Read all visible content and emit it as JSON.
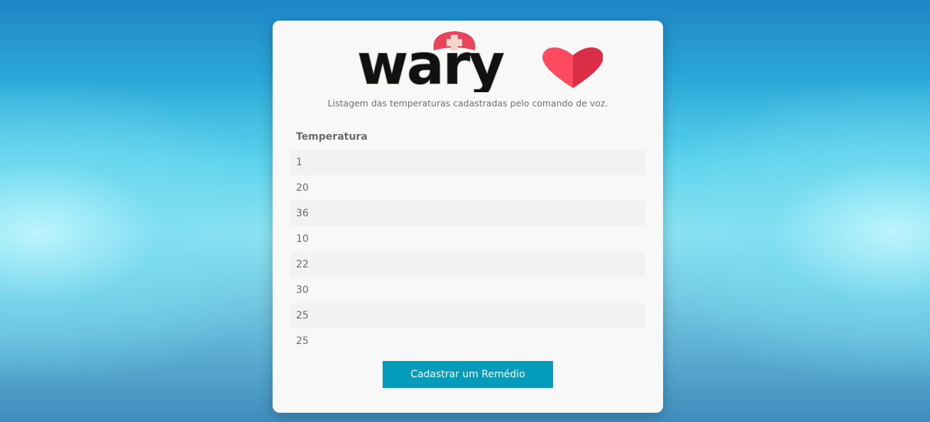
{
  "logo": {
    "text": "wary",
    "colors": {
      "wordmark": "#111111",
      "wordmark_outline": "#c9c6b8",
      "cap": "#e8445a",
      "cross": "#f6d6c8",
      "heart": "#e8364f"
    }
  },
  "subtitle": "Listagem das temperaturas cadastradas pelo comando de voz.",
  "table": {
    "header": "Temperatura",
    "rows": [
      "1",
      "20",
      "36",
      "10",
      "22",
      "30",
      "25",
      "25"
    ]
  },
  "button": {
    "label": "Cadastrar um Remédio",
    "color": "#049cba"
  }
}
